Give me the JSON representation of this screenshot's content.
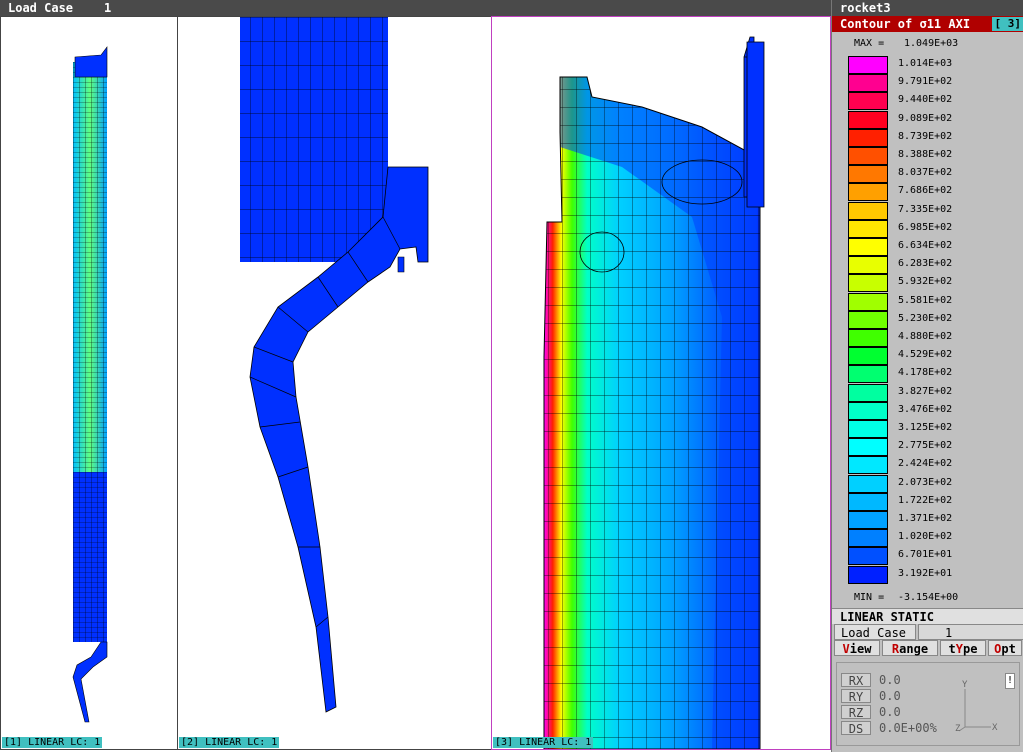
{
  "header": {
    "load_case_label": "Load Case",
    "load_case_number": "1"
  },
  "viewports": [
    {
      "label": "[1] LINEAR LC: 1"
    },
    {
      "label": "[2] LINEAR LC: 1"
    },
    {
      "label": "[3] LINEAR LC: 1"
    }
  ],
  "panel": {
    "model_name": "rocket3",
    "contour_title": "Contour of σ11 AXI",
    "contour_tag": "[ 3]",
    "max_label": "MAX =",
    "max_value": "1.049E+03",
    "min_label": "MIN =",
    "min_value": "-3.154E+00",
    "legend": [
      {
        "value": "1.014E+03",
        "color": "#ff00ff"
      },
      {
        "value": "9.791E+02",
        "color": "#ff0090"
      },
      {
        "value": "9.440E+02",
        "color": "#ff0050"
      },
      {
        "value": "9.089E+02",
        "color": "#ff0020"
      },
      {
        "value": "8.739E+02",
        "color": "#ff2000"
      },
      {
        "value": "8.388E+02",
        "color": "#ff5000"
      },
      {
        "value": "8.037E+02",
        "color": "#ff7800"
      },
      {
        "value": "7.686E+02",
        "color": "#ffa000"
      },
      {
        "value": "7.335E+02",
        "color": "#ffc800"
      },
      {
        "value": "6.985E+02",
        "color": "#ffe600"
      },
      {
        "value": "6.634E+02",
        "color": "#ffff00"
      },
      {
        "value": "6.283E+02",
        "color": "#e8ff00"
      },
      {
        "value": "5.932E+02",
        "color": "#c8ff00"
      },
      {
        "value": "5.581E+02",
        "color": "#a0ff00"
      },
      {
        "value": "5.230E+02",
        "color": "#70ff00"
      },
      {
        "value": "4.880E+02",
        "color": "#40ff00"
      },
      {
        "value": "4.529E+02",
        "color": "#00ff30"
      },
      {
        "value": "4.178E+02",
        "color": "#00ff70"
      },
      {
        "value": "3.827E+02",
        "color": "#00ffa0"
      },
      {
        "value": "3.476E+02",
        "color": "#00ffc8"
      },
      {
        "value": "3.125E+02",
        "color": "#00ffe6"
      },
      {
        "value": "2.775E+02",
        "color": "#00ffff"
      },
      {
        "value": "2.424E+02",
        "color": "#00e8ff"
      },
      {
        "value": "2.073E+02",
        "color": "#00d0ff"
      },
      {
        "value": "1.722E+02",
        "color": "#00b8ff"
      },
      {
        "value": "1.371E+02",
        "color": "#00a0ff"
      },
      {
        "value": "1.020E+02",
        "color": "#0080ff"
      },
      {
        "value": "6.701E+01",
        "color": "#0050ff"
      },
      {
        "value": "3.192E+01",
        "color": "#0020ff"
      }
    ],
    "analysis_type": "LINEAR STATIC",
    "load_case_label": "Load Case",
    "load_case_number": "1",
    "menu": [
      {
        "pre": "",
        "hot": "V",
        "post": "iew"
      },
      {
        "pre": "",
        "hot": "R",
        "post": "ange"
      },
      {
        "pre": "t",
        "hot": "Y",
        "post": "pe"
      },
      {
        "pre": "",
        "hot": "O",
        "post": "pt"
      }
    ],
    "coords": [
      {
        "key": "RX",
        "value": "0.0"
      },
      {
        "key": "RY",
        "value": "0.0"
      },
      {
        "key": "RZ",
        "value": "0.0"
      },
      {
        "key": "DS",
        "value": "0.0E+00%"
      }
    ],
    "triad": {
      "y": "Y",
      "z": "Z",
      "x": "X"
    }
  }
}
